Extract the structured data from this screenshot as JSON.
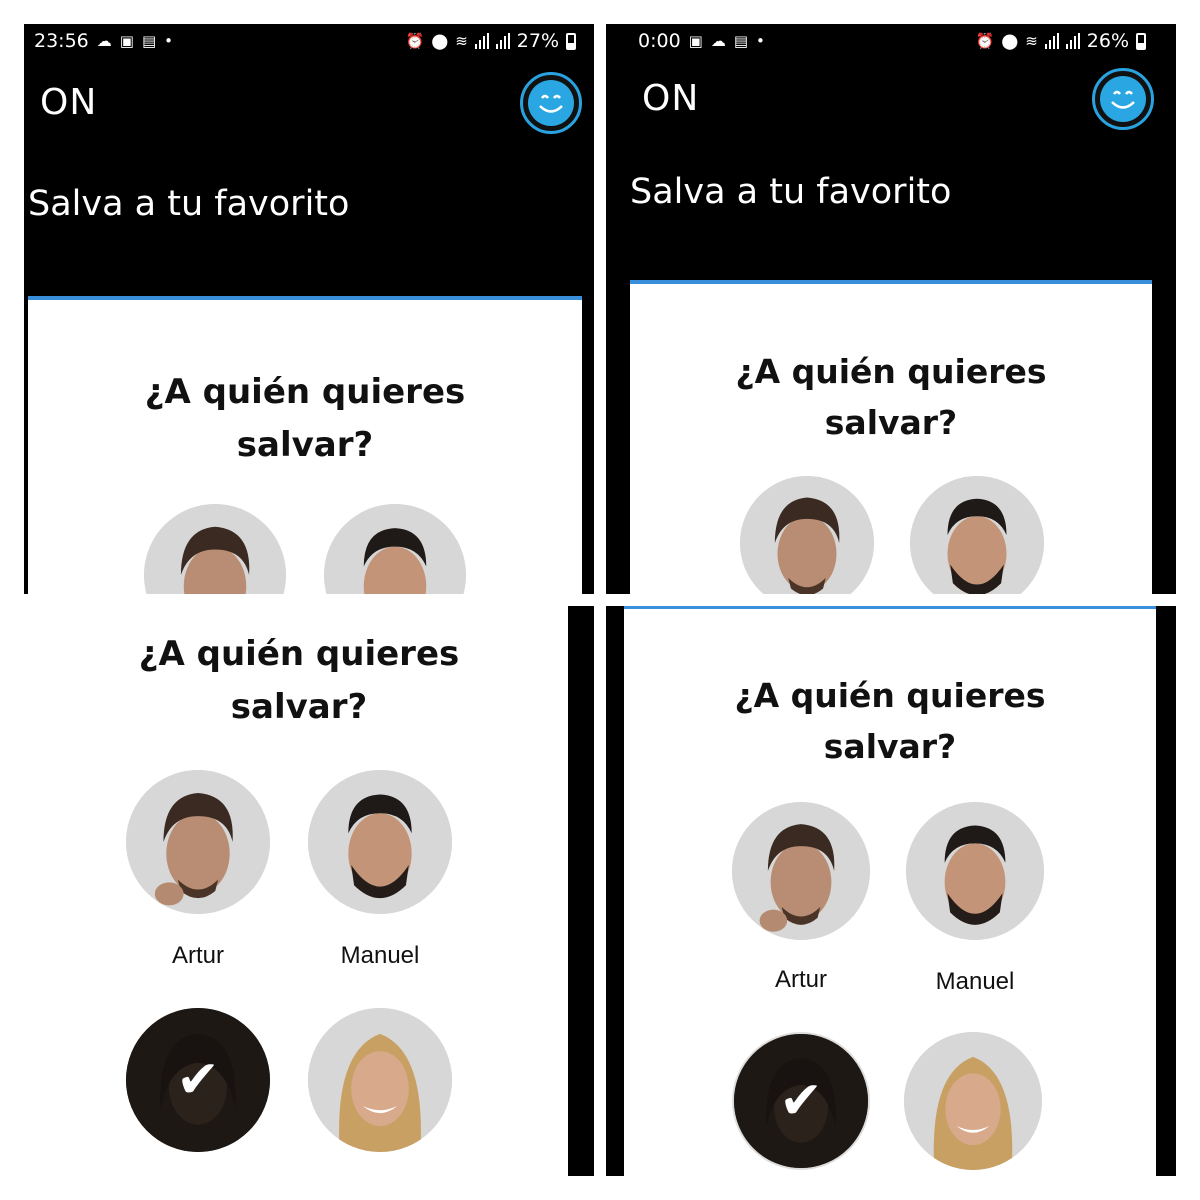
{
  "screens": [
    {
      "status": {
        "time": "23:56",
        "battery": "27%"
      },
      "app_title": "ON",
      "subtitle": "Salva a tu favorito",
      "question_line1": "¿A quién quieres",
      "question_line2": "salvar?"
    },
    {
      "status": {
        "time": "0:00",
        "battery": "26%"
      },
      "app_title": "ON",
      "subtitle": "Salva a tu favorito",
      "question_line1": "¿A quién quieres",
      "question_line2": "salvar?"
    },
    {
      "question_line1": "¿A quién quieres",
      "question_line2": "salvar?",
      "candidates": [
        {
          "name": "Artur"
        },
        {
          "name": "Manuel"
        }
      ],
      "selected_icon": "checkmark-icon"
    },
    {
      "question_line1": "¿A quién quieres",
      "question_line2": "salvar?",
      "candidates": [
        {
          "name": "Artur"
        },
        {
          "name": "Manuel"
        }
      ],
      "selected_icon": "checkmark-icon"
    }
  ],
  "colors": {
    "accent": "#2aa7e3",
    "header_bg": "#000000",
    "card_border": "#3a8fdc"
  }
}
